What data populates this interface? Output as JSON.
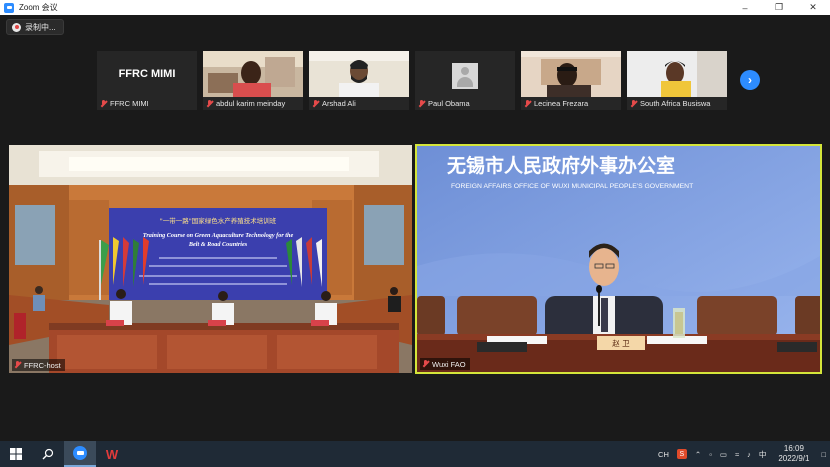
{
  "window": {
    "title": "Zoom 会议"
  },
  "recording": {
    "label": "录制中..."
  },
  "gallery": {
    "participants": [
      {
        "name": "FFRC MIMI",
        "type": "name",
        "display": "FFRC MIMI"
      },
      {
        "name": "abdul karim meinday",
        "type": "video"
      },
      {
        "name": "Arshad Ali",
        "type": "video"
      },
      {
        "name": "Paul Obama",
        "type": "avatar"
      },
      {
        "name": "Lecinea Frezara",
        "type": "video"
      },
      {
        "name": "South Africa Busiswa",
        "type": "video"
      }
    ]
  },
  "main": {
    "left": {
      "label": "FFRC-host",
      "banner_cn": "\"一带一路\"国家绿色水产养殖技术培训班",
      "banner_en1": "Training Course on Green Aquaculture Technology for the",
      "banner_en2": "Belt & Road Countries"
    },
    "right": {
      "label": "Wuxi FAO",
      "header_cn": "无锡市人民政府外事办公室",
      "header_en": "FOREIGN AFFAIRS OFFICE OF WUXI MUNICIPAL PEOPLE'S GOVERNMENT",
      "nameplate": "赵 卫"
    }
  },
  "taskbar": {
    "ime": "CH",
    "time": "16:09",
    "date": "2022/9/1"
  }
}
